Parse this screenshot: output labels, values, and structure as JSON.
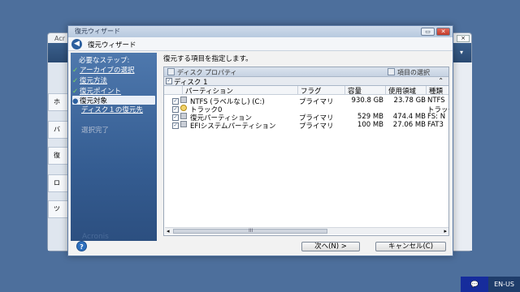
{
  "background_app": {
    "title_partial": "Acr",
    "tabs": [
      "ホ",
      "バ",
      "復",
      "ロ",
      "ツ"
    ],
    "close_label": "×",
    "menu_icon": "chevron-down-icon"
  },
  "dialog": {
    "caption": "復元ウィザード",
    "min_label": "▭",
    "close_label": "✕",
    "header_title": "復元ウィザード",
    "back_icon": "back-arrow-icon"
  },
  "steps": {
    "heading": "必要なステップ:",
    "items": [
      {
        "label": "アーカイブの選択",
        "state": "done"
      },
      {
        "label": "復元方法",
        "state": "done"
      },
      {
        "label": "復元ポイント",
        "state": "done"
      },
      {
        "label": "復元対象",
        "state": "current"
      },
      {
        "label": "ディスク１の復元先",
        "state": "pending"
      },
      {
        "label": "選択完了",
        "state": "disabled"
      }
    ],
    "watermark": "Acronis"
  },
  "main": {
    "instruction": "復元する項目を指定します。",
    "toolbar": {
      "disk_properties": "ディスク プロパティ",
      "item_select": "項目の選択"
    },
    "group": {
      "label": "ディスク 1",
      "collapse": "⌃"
    },
    "columns": [
      "パーティション",
      "フラグ",
      "容量",
      "使用領域",
      "種類"
    ],
    "rows": [
      {
        "name": "NTFS (ラベルなし) (C:)",
        "flag": "プライマリ",
        "capacity": "930.8 GB",
        "used": "23.78 GB",
        "type": "NTFS",
        "icon": "disk-icon"
      },
      {
        "name": "トラック0",
        "flag": "",
        "capacity": "",
        "used": "",
        "type": "トラック",
        "icon": "track-icon"
      },
      {
        "name": "復元パーティション",
        "flag": "プライマリ",
        "capacity": "529 MB",
        "used": "474.4 MB",
        "type": "FS: N",
        "icon": "disk-icon"
      },
      {
        "name": "EFIシステムパーティション",
        "flag": "プライマリ",
        "capacity": "100 MB",
        "used": "27.06 MB",
        "type": "FAT3",
        "icon": "disk-icon"
      }
    ],
    "scroll_left": "◂",
    "scroll_right": "▸",
    "scroll_grip": "III"
  },
  "buttons": {
    "next": "次へ(N) >",
    "cancel": "キャンセル(C)",
    "help": "?"
  },
  "taskbar": {
    "notification": "💬",
    "language": "EN-US"
  }
}
